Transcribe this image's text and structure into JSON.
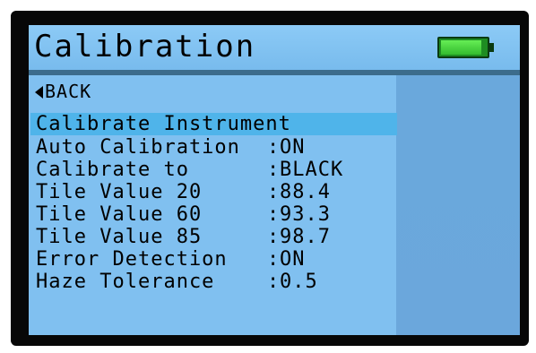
{
  "header": {
    "title": "Calibration",
    "battery_level": 0.9
  },
  "nav": {
    "back_label": "BACK"
  },
  "menu": {
    "action_label": "Calibrate Instrument",
    "colon": ":",
    "settings": [
      {
        "label": "Auto Calibration",
        "value": "ON"
      },
      {
        "label": "Calibrate to",
        "value": "BLACK"
      },
      {
        "label": "Tile Value 20",
        "value": "88.4"
      },
      {
        "label": "Tile Value 60",
        "value": "93.3"
      },
      {
        "label": "Tile Value 85",
        "value": "98.7"
      },
      {
        "label": "Error Detection",
        "value": "ON"
      },
      {
        "label": "Haze Tolerance",
        "value": "0.5"
      }
    ]
  },
  "colors": {
    "screen_bg": "#80c0f0",
    "highlight": "#4fb4ea",
    "battery": "#44dd3a"
  }
}
